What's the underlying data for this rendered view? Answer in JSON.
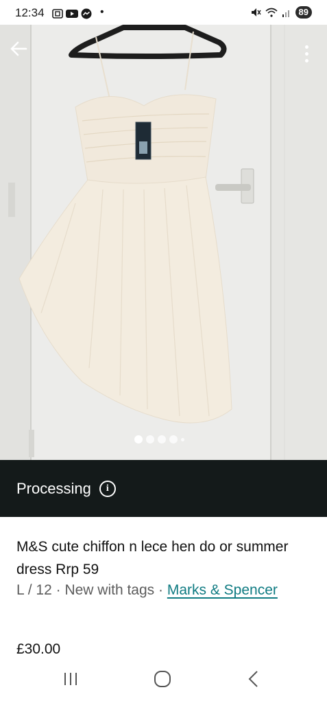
{
  "status_bar": {
    "time": "12:34",
    "battery": "89"
  },
  "photo": {
    "description_icon_back": "arrow-left-icon",
    "description_icon_more": "more-vertical-icon",
    "carousel_count": 5,
    "carousel_active_index": 0
  },
  "banner": {
    "label": "Processing",
    "icon": "info-icon"
  },
  "listing": {
    "title": "M&S cute chiffon n lece hen do or summer dress Rrp 59",
    "size": "L / 12",
    "separator": " · ",
    "condition": "New with tags",
    "brand": "Marks & Spencer",
    "price": "£30.00"
  },
  "nav": {
    "recent": "recent-apps-icon",
    "home": "home-icon",
    "back": "back-chevron-icon"
  },
  "colors": {
    "banner_bg": "#141a1a",
    "brand_link": "#0f7b82"
  }
}
